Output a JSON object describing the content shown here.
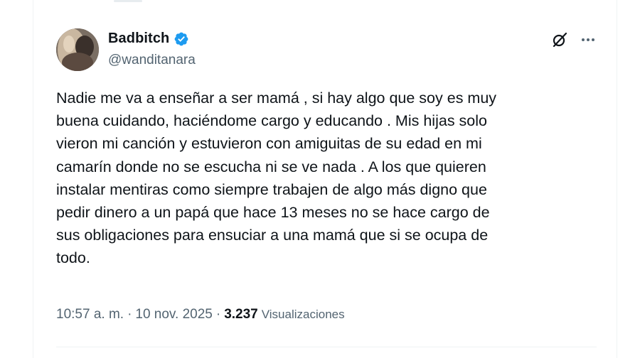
{
  "author": {
    "display_name": "Badbitch",
    "handle": "@wanditanara",
    "verified_color": "#1d9bf0"
  },
  "tweet": {
    "lines": [
      "Nadie me va a enseñar a ser mamá , si hay algo que soy es muy",
      "buena cuidando, haciéndome cargo y educando . Mis hijas solo",
      "vieron mi canción y estuvieron con amiguitas de su edad en mi",
      "camarín donde no se escucha ni se ve nada . A los que quieren",
      "instalar mentiras como siempre trabajen de algo más digno que",
      "pedir dinero a un papá que hace 13 meses no se hace cargo de",
      "sus obligaciones para ensuciar a una mamá que si se ocupa de",
      "todo."
    ]
  },
  "meta": {
    "time": "10:57 a. m.",
    "separator": "·",
    "date": "10 nov. 2025",
    "views_count": "3.237",
    "views_label": "Visualizaciones"
  },
  "icons": {
    "verified": "verified-badge-icon",
    "grok": "grok-icon",
    "more": "more-icon"
  }
}
